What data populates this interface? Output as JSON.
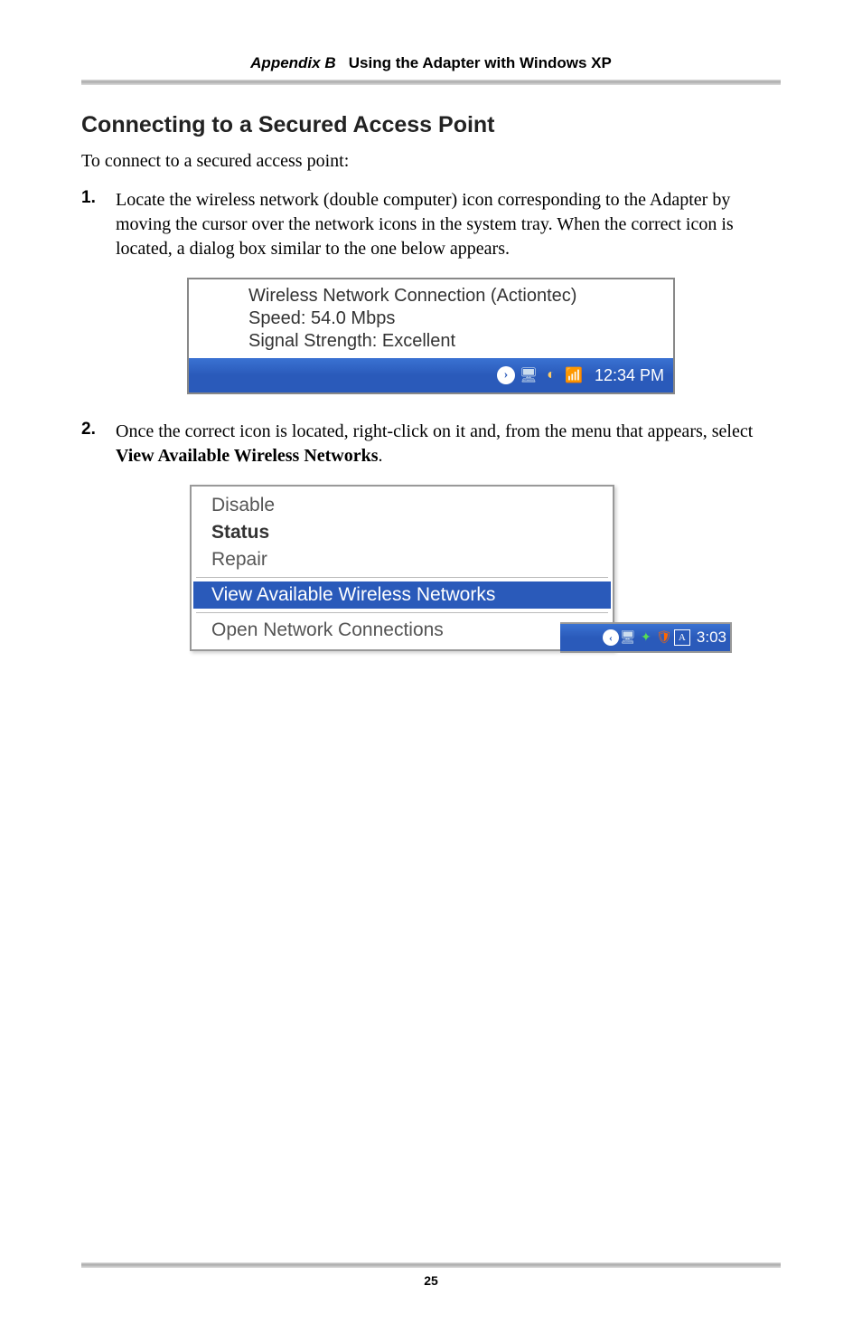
{
  "header": {
    "appendix": "Appendix B",
    "title": "Using the Adapter with Windows XP"
  },
  "section": {
    "heading": "Connecting to a Secured Access Point",
    "intro": "To connect to a secured access point:"
  },
  "steps": [
    {
      "num": "1.",
      "text": "Locate the wireless network (double computer) icon corresponding to the Adapter by moving the cursor over the network icons in the system tray. When the correct icon is located, a dialog box similar to the one below appears."
    },
    {
      "num": "2.",
      "text_pre": "Once the correct icon is located, right-click on it and, from the menu that appears, select ",
      "bold": "View Available Wireless Networks",
      "text_post": "."
    }
  ],
  "figure1": {
    "tooltip_line1": "Wireless Network Connection (Actiontec)",
    "tooltip_line2": "Speed: 54.0 Mbps",
    "tooltip_line3": "Signal Strength: Excellent",
    "clock": "12:34 PM"
  },
  "figure2": {
    "menu": {
      "disable": "Disable",
      "status": "Status",
      "repair": "Repair",
      "view": "View Available Wireless Networks",
      "open": "Open Network Connections"
    },
    "clock": "3:03"
  },
  "footer": {
    "page": "25"
  }
}
